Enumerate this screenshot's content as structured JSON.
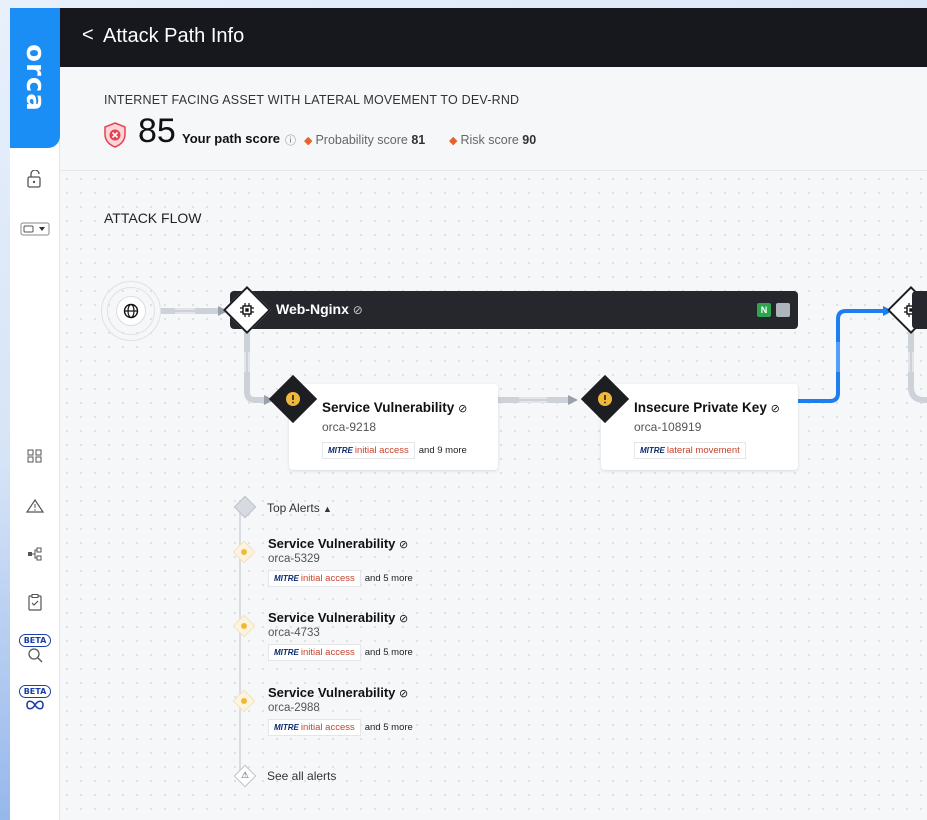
{
  "app": {
    "brand": "orca"
  },
  "sidebar": {
    "beta_label_1": "BETA",
    "beta_label_2": "BETA"
  },
  "topbar": {
    "back_label": "<",
    "title": "Attack Path Info"
  },
  "header": {
    "path_title": "INTERNET FACING ASSET WITH LATERAL MOVEMENT TO DEV-RND",
    "score": "85",
    "score_label": "Your path score",
    "probability_label": "Probability score",
    "probability_value": "81",
    "risk_label": "Risk score",
    "risk_value": "90"
  },
  "flow": {
    "title": "ATTACK FLOW",
    "asset": {
      "name": "Web-Nginx",
      "badge": "N"
    },
    "cards": [
      {
        "title": "Service Vulnerability",
        "id": "orca-9218",
        "mitre": "MITRE",
        "tag": "initial access",
        "more": "and 9 more"
      },
      {
        "title": "Insecure Private Key",
        "id": "orca-108919",
        "mitre": "MITRE",
        "tag": "lateral movement",
        "more": ""
      }
    ]
  },
  "alerts": {
    "header": "Top Alerts",
    "items": [
      {
        "title": "Service Vulnerability",
        "id": "orca-5329",
        "mitre": "MITRE",
        "tag": "initial access",
        "more": "and 5 more"
      },
      {
        "title": "Service Vulnerability",
        "id": "orca-4733",
        "mitre": "MITRE",
        "tag": "initial access",
        "more": "and 5 more"
      },
      {
        "title": "Service Vulnerability",
        "id": "orca-2988",
        "mitre": "MITRE",
        "tag": "initial access",
        "more": "and 5 more"
      }
    ],
    "see_all": "See all alerts"
  },
  "colors": {
    "brand": "#1a8ef5",
    "accent_line": "#1e7ef0",
    "score_shield": "#e8414f",
    "mitre_tag": "#c4442d",
    "alert_dot": "#f0b93a"
  }
}
